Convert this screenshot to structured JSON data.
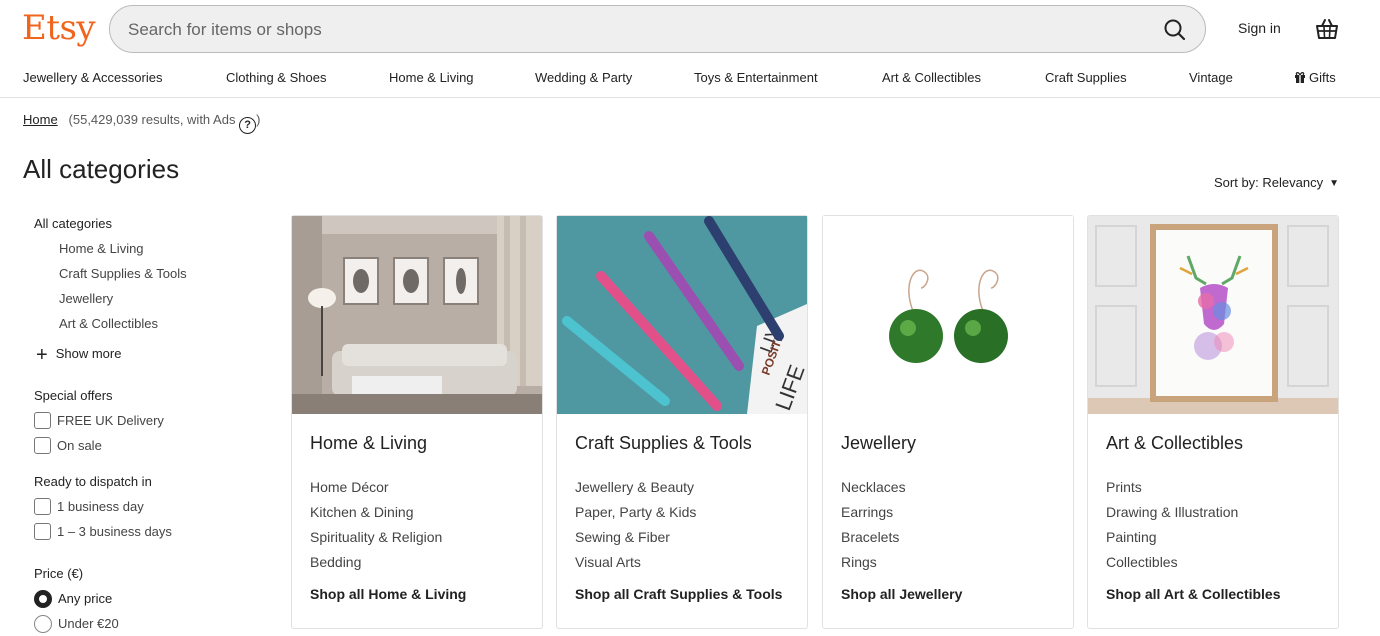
{
  "brand": {
    "logo": "Etsy",
    "accent": "#F1641E"
  },
  "search": {
    "placeholder": "Search for items or shops",
    "value": "",
    "icon": "search-icon"
  },
  "header": {
    "signin": "Sign in",
    "basket_icon": "basket-icon"
  },
  "nav": {
    "items": [
      "Jewellery & Accessories",
      "Clothing & Shoes",
      "Home & Living",
      "Wedding & Party",
      "Toys & Entertainment",
      "Art & Collectibles",
      "Craft Supplies",
      "Vintage"
    ],
    "gifts": "Gifts"
  },
  "breadcrumb": {
    "home": "Home",
    "results": "(55,429,039 results, with Ads",
    "close": ")",
    "help_glyph": "?"
  },
  "page": {
    "title": "All categories",
    "sort": "Sort by: Relevancy"
  },
  "sidebar": {
    "all_categories": "All categories",
    "categories": [
      "Home & Living",
      "Craft Supplies & Tools",
      "Jewellery",
      "Art & Collectibles"
    ],
    "show_more": "Show more",
    "special_offers": {
      "heading": "Special offers",
      "options": [
        "FREE UK Delivery",
        "On sale"
      ]
    },
    "dispatch": {
      "heading": "Ready to dispatch in",
      "options": [
        "1 business day",
        "1 – 3 business days"
      ]
    },
    "price": {
      "heading": "Price (€)",
      "options": [
        "Any price",
        "Under €20"
      ],
      "selected": "Any price"
    }
  },
  "cards": [
    {
      "title": "Home & Living",
      "links": [
        "Home Décor",
        "Kitchen & Dining",
        "Spirituality & Religion",
        "Bedding"
      ],
      "shop_all": "Shop all Home & Living"
    },
    {
      "title": "Craft Supplies & Tools",
      "links": [
        "Jewellery & Beauty",
        "Paper, Party & Kids",
        "Sewing & Fiber",
        "Visual Arts"
      ],
      "shop_all": "Shop all Craft Supplies & Tools",
      "image_text": [
        "LIV",
        "POSITI",
        "LIFE"
      ]
    },
    {
      "title": "Jewellery",
      "links": [
        "Necklaces",
        "Earrings",
        "Bracelets",
        "Rings"
      ],
      "shop_all": "Shop all Jewellery"
    },
    {
      "title": "Art & Collectibles",
      "links": [
        "Prints",
        "Drawing & Illustration",
        "Painting",
        "Collectibles"
      ],
      "shop_all": "Shop all Art & Collectibles"
    }
  ]
}
